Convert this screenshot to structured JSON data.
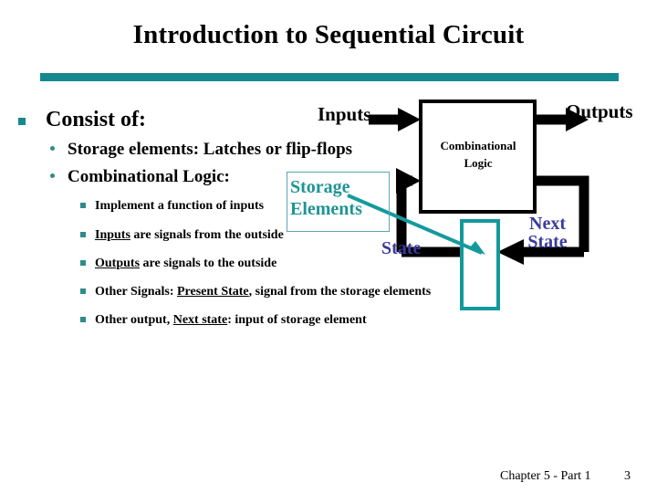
{
  "slide": {
    "title": "Introduction to Sequential Circuit",
    "accent_teal": "#13888E",
    "accent_purple": "#3B3B9E"
  },
  "bullets": {
    "level1": "Consist of:",
    "level2": [
      "Storage elements: Latches or flip-flops",
      "Combinational Logic:"
    ],
    "level3": [
      {
        "pre": "",
        "underline": "",
        "post": "Implement a function of inputs"
      },
      {
        "pre": "",
        "underline": "Inputs",
        "post": " are signals from the outside"
      },
      {
        "pre": "",
        "underline": "Outputs",
        "post": " are signals to the outside"
      },
      {
        "pre": "Other Signals: ",
        "underline": "Present State",
        "post": ", signal from the storage elements"
      },
      {
        "pre": "Other output, ",
        "underline": "Next state",
        "post": ": input of storage element"
      }
    ]
  },
  "diagram": {
    "inputs_label": "Inputs",
    "outputs_label": "Outputs",
    "comb_logic_line1": "Combinational",
    "comb_logic_line2": "Logic",
    "state_label": "State",
    "next_state_line1": "Next",
    "next_state_line2": "State",
    "storage_line1": "Storage",
    "storage_line2": "Elements"
  },
  "footer": {
    "chapter": "Chapter 5 - Part 1",
    "page": "3"
  }
}
